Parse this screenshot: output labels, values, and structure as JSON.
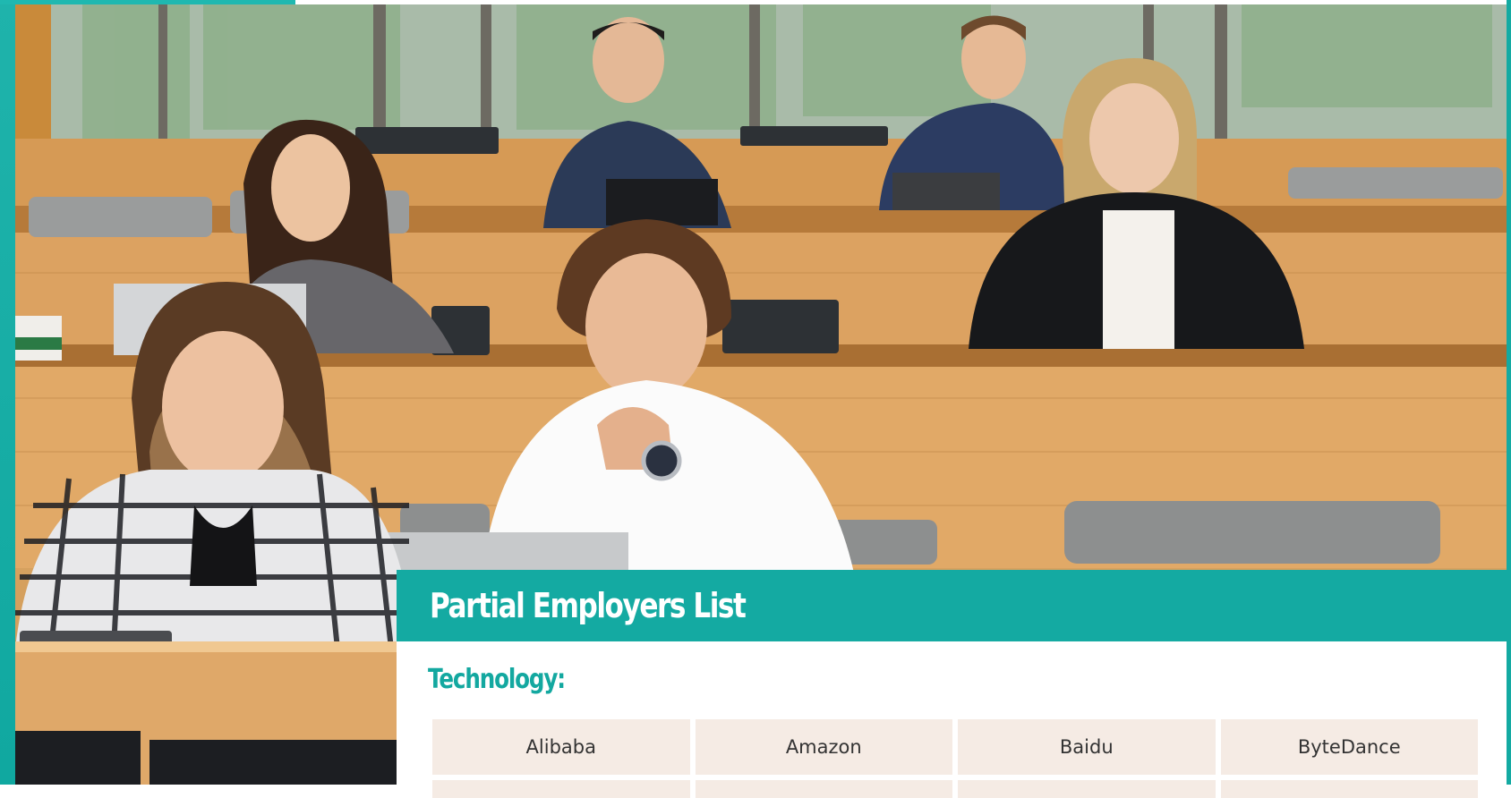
{
  "panel": {
    "title": "Partial Employers List",
    "section": "Technology:",
    "employers": [
      "Alibaba",
      "Amazon",
      "Baidu",
      "ByteDance"
    ]
  },
  "colors": {
    "teal": "#14aaa2",
    "cell_bg": "#f5ebe4",
    "section_text": "#13a8a0"
  },
  "photo": {
    "icon": "classroom-photo"
  }
}
